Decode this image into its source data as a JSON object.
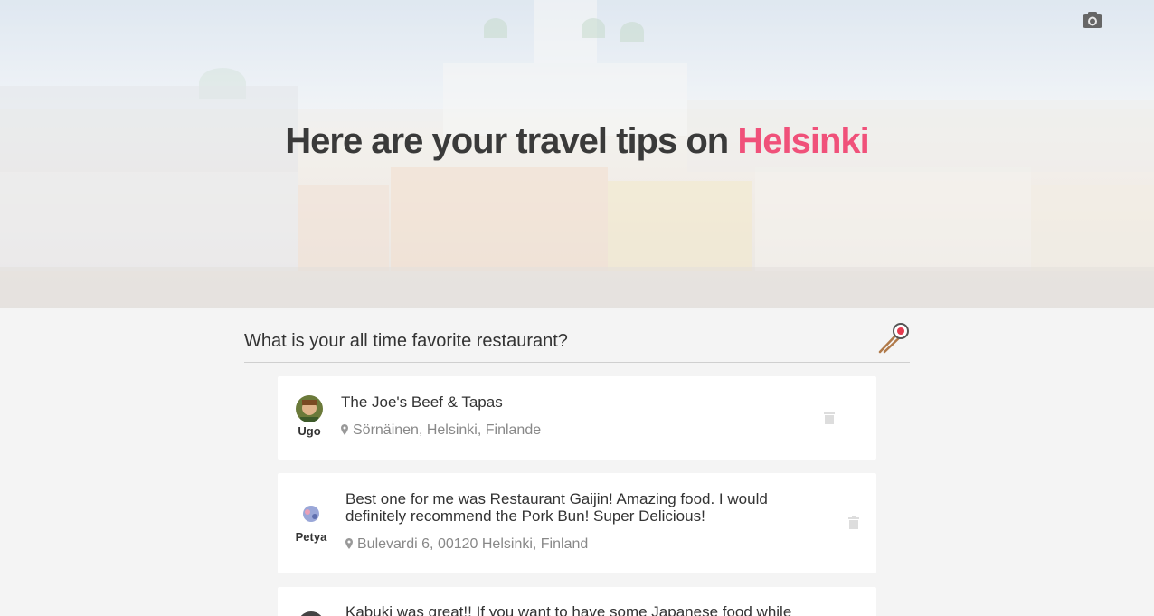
{
  "hero": {
    "title_prefix": "Here are your travel tips on ",
    "city": "Helsinki",
    "camera_icon": "camera-icon"
  },
  "question": {
    "text": "What is your all time favorite restaurant?",
    "icon": "sushi-icon"
  },
  "tips": [
    {
      "author": "Ugo",
      "text": "The Joe's Beef & Tapas",
      "location": "Sörnäinen, Helsinki, Finlande"
    },
    {
      "author": "Petya",
      "text": "Best one for me was Restaurant Gaijin! Amazing food. I would definitely recommend the Pork Bun! Super Delicious!",
      "location": "Bulevardi 6, 00120 Helsinki, Finland"
    },
    {
      "author": "",
      "text": "Kabuki was great!! If you want to have some Japanese food while",
      "location": ""
    }
  ],
  "colors": {
    "accent": "#f0517a",
    "text": "#333333",
    "muted": "#888888"
  }
}
